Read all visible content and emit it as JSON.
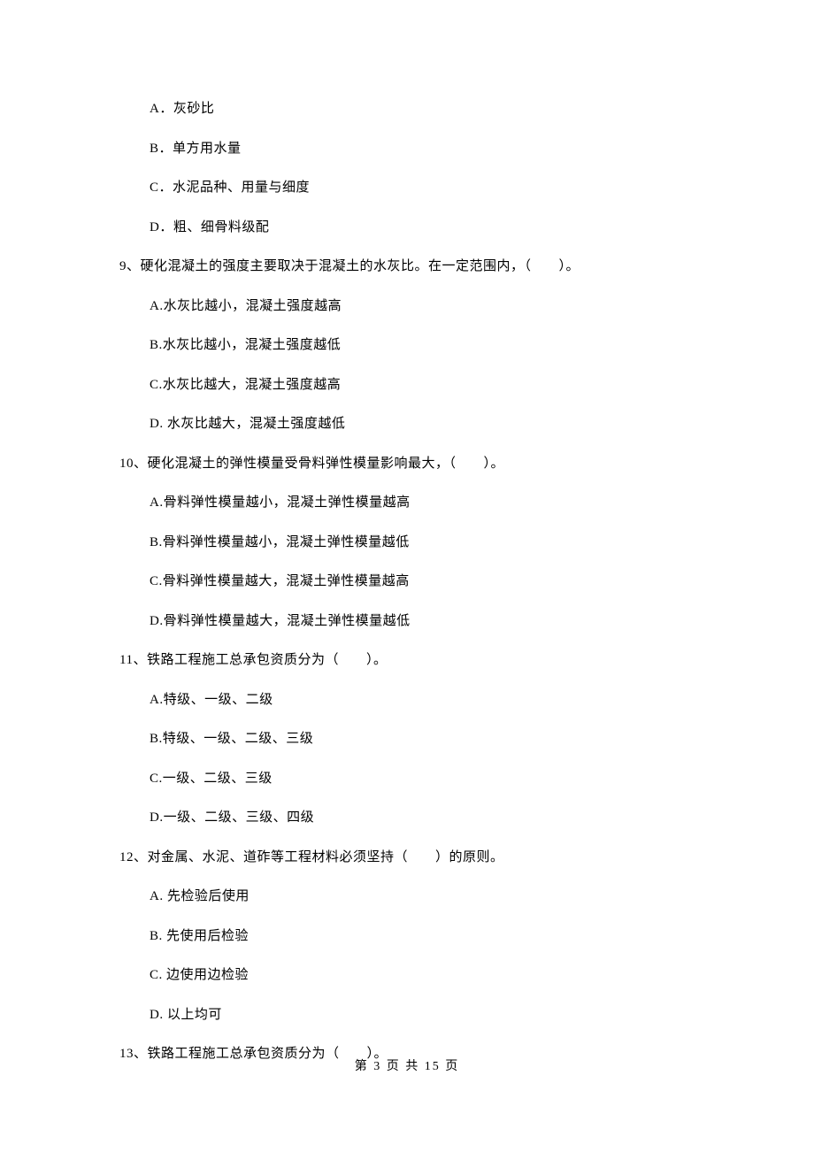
{
  "q8": {
    "options": {
      "a": "A．灰砂比",
      "b": "B．单方用水量",
      "c": "C．水泥品种、用量与细度",
      "d": "D．粗、细骨料级配"
    }
  },
  "q9": {
    "text": "9、硬化混凝土的强度主要取决于混凝土的水灰比。在一定范围内，（　　）。",
    "options": {
      "a": "A.水灰比越小，混凝土强度越高",
      "b": "B.水灰比越小，混凝土强度越低",
      "c": "C.水灰比越大，混凝土强度越高",
      "d": "D. 水灰比越大，混凝土强度越低"
    }
  },
  "q10": {
    "text": "10、硬化混凝土的弹性模量受骨料弹性模量影响最大，（　　）。",
    "options": {
      "a": "A.骨料弹性模量越小，混凝土弹性模量越高",
      "b": "B.骨料弹性模量越小，混凝土弹性模量越低",
      "c": "C.骨料弹性模量越大，混凝土弹性模量越高",
      "d": "D.骨料弹性模量越大，混凝土弹性模量越低"
    }
  },
  "q11": {
    "text": "11、铁路工程施工总承包资质分为（　　）。",
    "options": {
      "a": "A.特级、一级、二级",
      "b": "B.特级、一级、二级、三级",
      "c": "C.一级、二级、三级",
      "d": "D.一级、二级、三级、四级"
    }
  },
  "q12": {
    "text": "12、对金属、水泥、道砟等工程材料必须坚持（　　）的原则。",
    "options": {
      "a": "A. 先检验后使用",
      "b": "B. 先使用后检验",
      "c": "C. 边使用边检验",
      "d": "D. 以上均可"
    }
  },
  "q13": {
    "text": "13、铁路工程施工总承包资质分为（　　）。"
  },
  "footer": "第 3 页 共 15 页"
}
